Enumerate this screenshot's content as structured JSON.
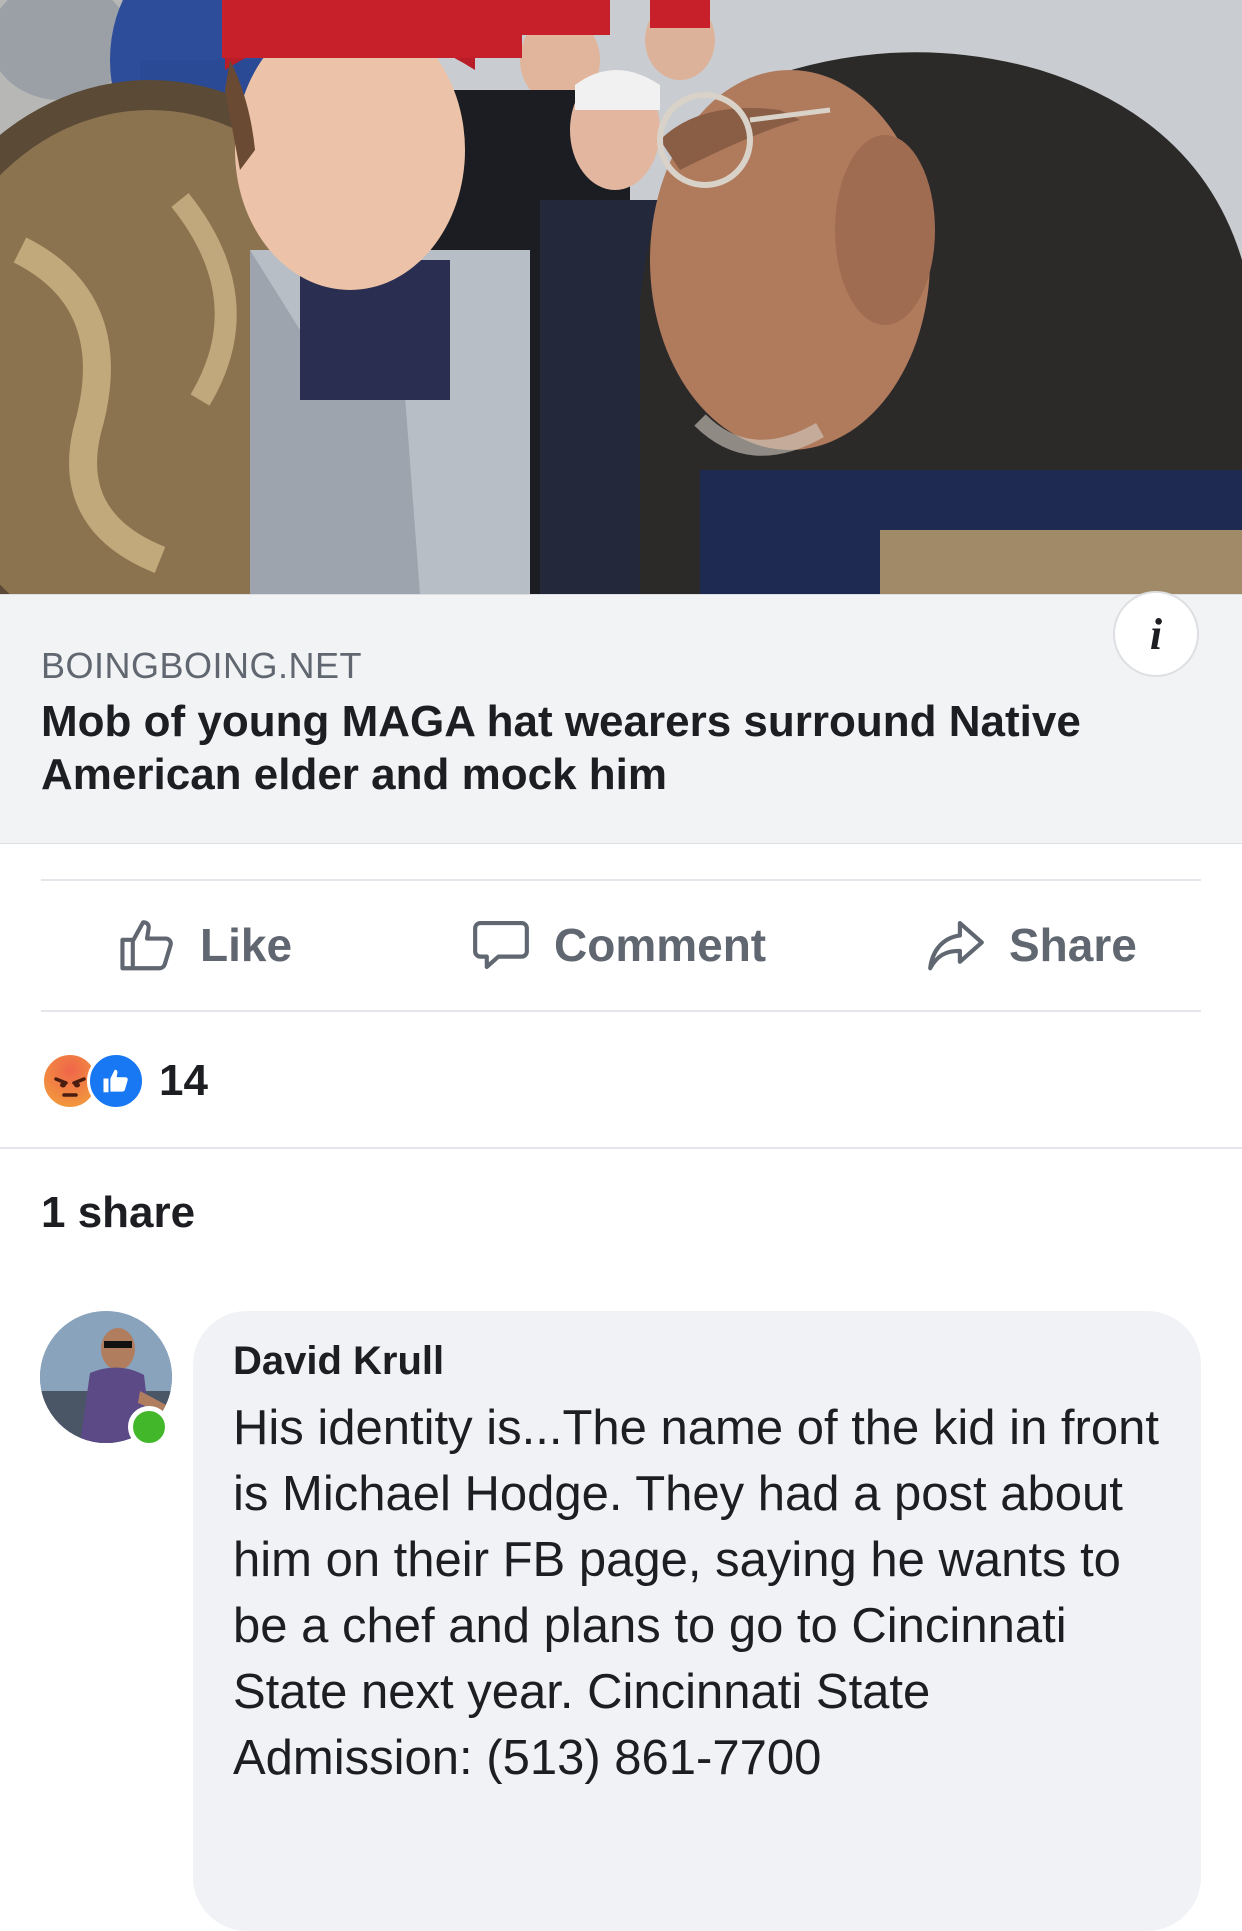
{
  "link_preview": {
    "domain": "BOINGBOING.NET",
    "title": "Mob of young MAGA hat wearers surround Native American elder and mock him",
    "info_icon": "info-icon",
    "info_glyph": "i"
  },
  "actions": {
    "like_label": "Like",
    "comment_label": "Comment",
    "share_label": "Share"
  },
  "reactions": {
    "types": [
      "angry",
      "like"
    ],
    "count": "14"
  },
  "shares": {
    "text": "1 share"
  },
  "comment": {
    "author": "David Krull",
    "online": true,
    "text": "His identity is...The name of the kid in front is Michael Hodge. They had a post about him on their FB page, saying he wants to be a chef and plans to go to Cincinnati State next year. Cincinnati State Admission: (513) 861-7700"
  },
  "colors": {
    "link_card_bg": "#f2f3f5",
    "action_text": "#606770",
    "like_blue": "#1877f2",
    "online_green": "#42b72a",
    "bubble_bg": "#f0f2f5"
  }
}
